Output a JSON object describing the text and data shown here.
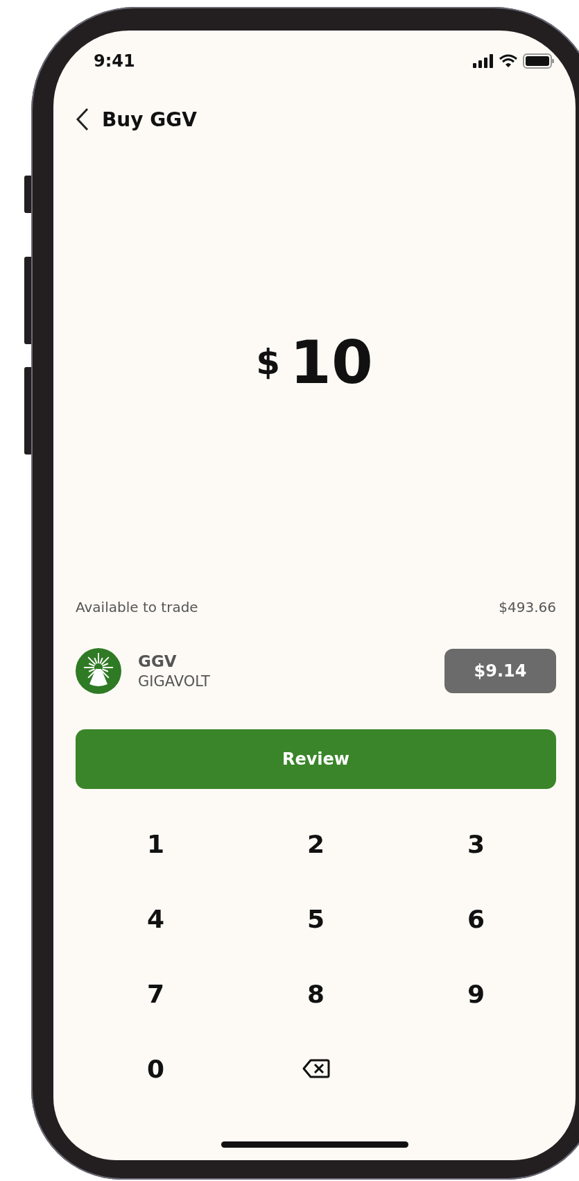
{
  "status_bar": {
    "time": "9:41"
  },
  "header": {
    "title": "Buy GGV"
  },
  "amount": {
    "currency": "$",
    "value": "10"
  },
  "available": {
    "label": "Available to trade",
    "value": "$493.66"
  },
  "stock": {
    "symbol": "GGV",
    "name": "GIGAVOLT",
    "price": "$9.14"
  },
  "review_button": {
    "label": "Review"
  },
  "keypad": [
    {
      "kind": "digit",
      "label": "1"
    },
    {
      "kind": "digit",
      "label": "2"
    },
    {
      "kind": "digit",
      "label": "3"
    },
    {
      "kind": "digit",
      "label": "4"
    },
    {
      "kind": "digit",
      "label": "5"
    },
    {
      "kind": "digit",
      "label": "6"
    },
    {
      "kind": "digit",
      "label": "7"
    },
    {
      "kind": "digit",
      "label": "8"
    },
    {
      "kind": "digit",
      "label": "9"
    },
    {
      "kind": "digit",
      "label": "0"
    },
    {
      "kind": "backspace"
    },
    {
      "kind": "blank"
    }
  ]
}
